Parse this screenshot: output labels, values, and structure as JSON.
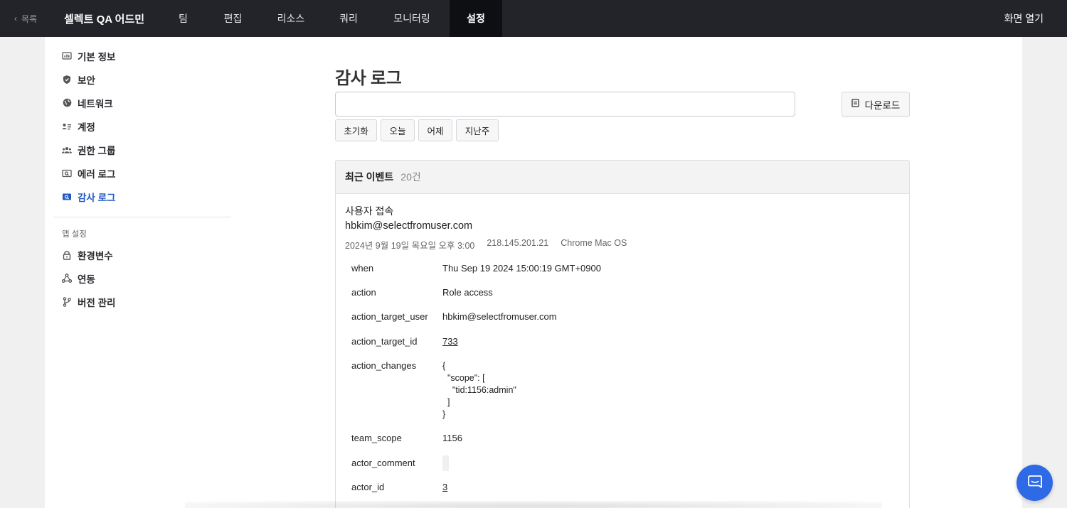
{
  "nav": {
    "back_label": "목록",
    "app_title": "셀렉트 QA 어드민",
    "tabs": [
      {
        "label": "팀"
      },
      {
        "label": "편집"
      },
      {
        "label": "리소스"
      },
      {
        "label": "쿼리"
      },
      {
        "label": "모니터링"
      },
      {
        "label": "설정"
      }
    ],
    "active_tab": "설정",
    "open_screen": "화면 열기"
  },
  "sidebar": {
    "items": [
      {
        "label": "기본 정보",
        "icon": "dashboard-icon"
      },
      {
        "label": "보안",
        "icon": "shield-icon"
      },
      {
        "label": "네트워크",
        "icon": "globe-icon"
      },
      {
        "label": "계정",
        "icon": "account-list-icon"
      },
      {
        "label": "권한 그룹",
        "icon": "users-icon"
      },
      {
        "label": "에러 로그",
        "icon": "error-log-icon"
      },
      {
        "label": "감사 로그",
        "icon": "audit-log-icon"
      }
    ],
    "active_item": "감사 로그",
    "group_title": "앱 설정",
    "app_items": [
      {
        "label": "환경변수",
        "icon": "lock-icon"
      },
      {
        "label": "연동",
        "icon": "network-nodes-icon"
      },
      {
        "label": "버전 관리",
        "icon": "git-branch-icon"
      }
    ]
  },
  "main": {
    "title": "감사 로그",
    "search": {
      "value": "",
      "placeholder": ""
    },
    "download_label": "다운로드",
    "quick_filters": [
      "초기화",
      "오늘",
      "어제",
      "지난주"
    ],
    "panel": {
      "title": "최근 이벤트",
      "count": "20건",
      "event": {
        "type": "사용자 접속",
        "user": "hbkim@selectfromuser.com",
        "datetime": "2024년 9월 19일 목요일 오후 3:00",
        "ip": "218.145.201.21",
        "client": "Chrome Mac OS",
        "fields": [
          {
            "key": "when",
            "value": "Thu Sep 19 2024 15:00:19 GMT+0900"
          },
          {
            "key": "action",
            "value": "Role access"
          },
          {
            "key": "action_target_user",
            "value": "hbkim@selectfromuser.com"
          },
          {
            "key": "action_target_id",
            "value": "733"
          },
          {
            "key": "action_changes",
            "value": "{\n  \"scope\": [\n    \"tid:1156:admin\"\n  ]\n}"
          },
          {
            "key": "team_scope",
            "value": "1156"
          },
          {
            "key": "actor_comment",
            "value": ""
          },
          {
            "key": "actor_id",
            "value": "3"
          }
        ]
      }
    }
  },
  "colors": {
    "topbar": "#23242a",
    "active_tab": "#0e0f12",
    "accent": "#1f57c7",
    "chat_button": "#2f6ae6"
  },
  "chat_icon": "chat-bubble-icon"
}
